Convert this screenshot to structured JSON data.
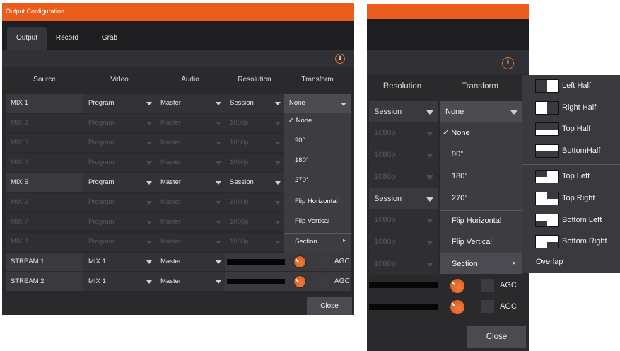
{
  "left_window": {
    "title": "Output Configuration",
    "tabs": [
      "Output",
      "Record",
      "Grab"
    ],
    "columns": [
      "Source",
      "Video",
      "Audio",
      "Resolution",
      "Transform"
    ],
    "rows": [
      {
        "source": "MIX 1",
        "video": "Program",
        "audio": "Master",
        "resolution": "Session",
        "transform": "None",
        "enabled": true
      },
      {
        "source": "MIX 2",
        "video": "Program",
        "audio": "Master",
        "resolution": "1080p",
        "enabled": false
      },
      {
        "source": "MIX 3",
        "video": "Program",
        "audio": "Master",
        "resolution": "1080p",
        "enabled": false
      },
      {
        "source": "MIX 4",
        "video": "Program",
        "audio": "Master",
        "resolution": "1080p",
        "enabled": false
      },
      {
        "source": "MIX 5",
        "video": "Program",
        "audio": "Master",
        "resolution": "Session",
        "enabled": true
      },
      {
        "source": "MIX 6",
        "video": "Program",
        "audio": "Master",
        "resolution": "1080p",
        "enabled": false
      },
      {
        "source": "MIX 7",
        "video": "Program",
        "audio": "Master",
        "resolution": "1080p",
        "enabled": false
      },
      {
        "source": "MIX 8",
        "video": "Program",
        "audio": "Master",
        "resolution": "1080p",
        "enabled": false
      },
      {
        "source": "STREAM 1",
        "video": "MIX 1",
        "audio": "Master",
        "agc": "AGC",
        "enabled": true
      },
      {
        "source": "STREAM 2",
        "video": "MIX 1",
        "audio": "Master",
        "agc": "AGC",
        "enabled": true
      }
    ],
    "transform_menu": [
      "✓ None",
      "90°",
      "180°",
      "270°",
      "Flip Horizontal",
      "Flip Vertical",
      "Section"
    ],
    "close_label": "Close"
  },
  "right_window": {
    "columns": [
      "Resolution",
      "Transform"
    ],
    "resolution_values": [
      "Session",
      "1080p",
      "1080p",
      "1080p",
      "Session",
      "1080p",
      "1080p",
      "1080p"
    ],
    "transform_selected": "None",
    "transform_menu": [
      "✓ None",
      "90°",
      "180°",
      "270°",
      "Flip Horizontal",
      "Flip Vertical",
      "Section"
    ],
    "agc_label": "AGC",
    "close_label": "Close"
  },
  "section_submenu": {
    "items": [
      "Left Half",
      "Right Half",
      "Top Half",
      "BottomHalf",
      "Top Left",
      "Top Right",
      "Bottom Left",
      "Bottom Right"
    ],
    "overlap_label": "Overlap"
  },
  "icons": {
    "info": "info-icon",
    "dropdown": "chevron-down-icon",
    "submenu": "chevron-right-icon",
    "audio_knob": "knob-icon"
  },
  "colors": {
    "accent": "#ea5d1d",
    "window_bg": "#2a2a2c",
    "row_bg": "#3a3a3e",
    "menu_bg": "#3d3d41"
  }
}
